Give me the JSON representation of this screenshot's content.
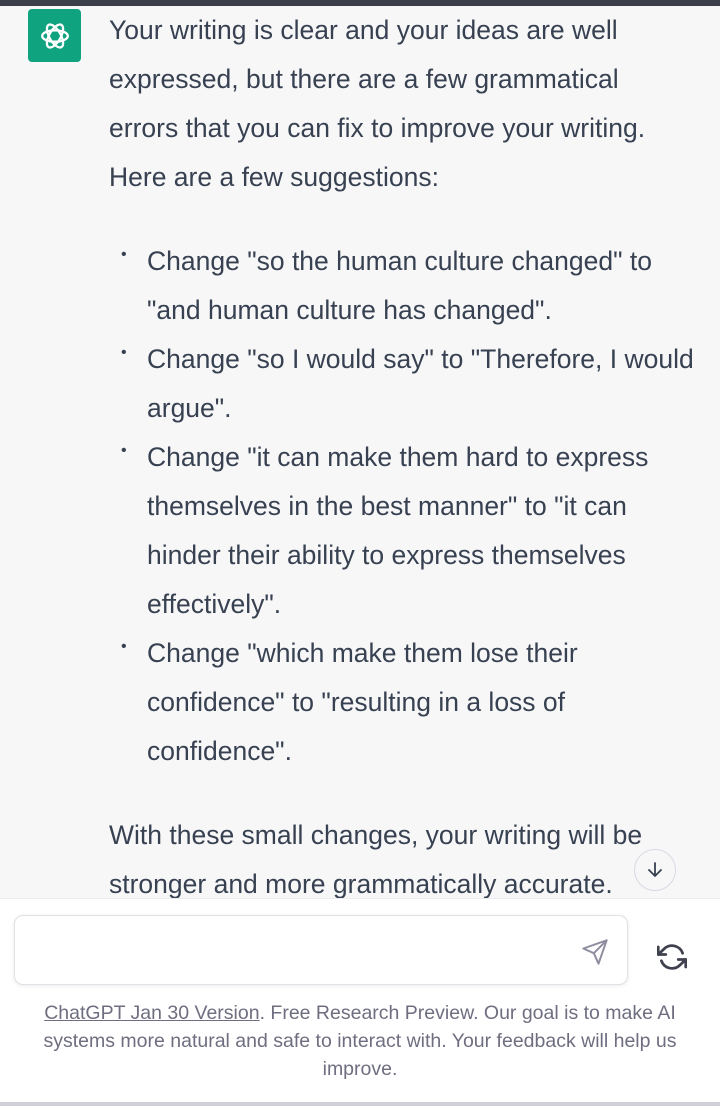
{
  "message": {
    "intro": "Your writing is clear and your ideas are well expressed, but there are a few grammatical errors that you can fix to improve your writing. Here are a few suggestions:",
    "suggestions": [
      "Change \"so the human culture changed\" to \"and human culture has changed\".",
      "Change \"so I would say\" to \"Therefore, I would argue\".",
      "Change \"it can make them hard to express themselves in the best manner\" to \"it can hinder their ability to express themselves effectively\".",
      "Change \"which make them lose their confidence\" to \"resulting in a loss of confidence\"."
    ],
    "conclusion": "With these small changes, your writing will be stronger and more grammatically accurate."
  },
  "composer": {
    "value": "",
    "placeholder": ""
  },
  "footer": {
    "version_link": "ChatGPT Jan 30 Version",
    "text": ". Free Research Preview. Our goal is to make AI systems more natural and safe to interact with. Your feedback will help us improve."
  },
  "icons": {
    "avatar": "openai-logo-icon",
    "scroll": "arrow-down-icon",
    "send": "send-icon",
    "regenerate": "refresh-icon"
  },
  "colors": {
    "brand": "#10a37f",
    "message_bg": "#f7f7f8",
    "text": "#374151",
    "muted": "#6e6e80"
  }
}
